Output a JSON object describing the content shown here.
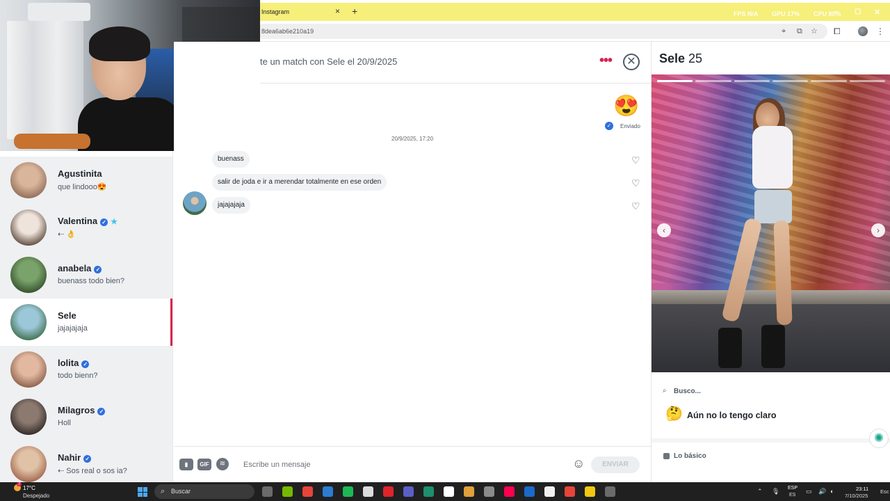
{
  "browser": {
    "tab_title": "Instagram",
    "tab_close": "×",
    "new_tab": "+",
    "url": "8dea6ab6e210a19",
    "perf_fps": "FPS N/A",
    "perf_gpu": "GPU 17%",
    "perf_cpu": "CPU 80%"
  },
  "matches": [
    {
      "name": "Agustinita",
      "last": "que lindooo😍",
      "verified": false,
      "star": false,
      "avatar_colors": [
        "#d9b59b",
        "#8f6b56"
      ]
    },
    {
      "name": "Valentina",
      "last": "⇠ 👌",
      "verified": true,
      "star": true,
      "avatar_colors": [
        "#efe4dc",
        "#5a4638"
      ]
    },
    {
      "name": "anabela",
      "last": "buenass todo bien?",
      "verified": true,
      "star": false,
      "avatar_colors": [
        "#7aa36b",
        "#324d2a"
      ]
    },
    {
      "name": "Sele",
      "last": "jajajajaja",
      "verified": false,
      "star": false,
      "avatar_colors": [
        "#9cc7d8",
        "#3e6d4a"
      ]
    },
    {
      "name": "lolita",
      "last": "todo bienn?",
      "verified": true,
      "star": false,
      "avatar_colors": [
        "#e2b9a0",
        "#8a5c48"
      ]
    },
    {
      "name": "Milagros",
      "last": "Holl",
      "verified": true,
      "star": false,
      "avatar_colors": [
        "#8c7a70",
        "#2f2825"
      ]
    },
    {
      "name": "Nahir",
      "last": "⇠ Sos real o sos ia?",
      "verified": true,
      "star": false,
      "avatar_colors": [
        "#e0c2a6",
        "#a0624a"
      ]
    }
  ],
  "chat": {
    "title": "te un match con Sele el 20/9/2025",
    "more_icon": "•••",
    "close_icon": "✕",
    "sent_emoji": "😍",
    "sent_check": "✓",
    "sent_label": "Enviado",
    "timestamp": "20/9/2025, 17:20",
    "messages": [
      "buenass",
      "salir de joda e ir a merendar totalmente en ese orden",
      "jajajajaja"
    ],
    "heart_icon": "♡",
    "gif_label": "GIF",
    "input_placeholder": "Escribe un mensaje",
    "emoji_icon": "☺",
    "send_label": "ENVIAR"
  },
  "profile": {
    "name": "Sele",
    "age": "25",
    "photo_count": 6,
    "photo_active": 0,
    "prev_icon": "‹",
    "next_icon": "›",
    "looking_label": "Busco...",
    "looking_emoji": "🤔",
    "looking_value": "Aún no lo tengo claro",
    "basics_label": "Lo básico"
  },
  "taskbar": {
    "weather_temp": "17°C",
    "weather_desc": "Despejado",
    "weather_badge": "7",
    "search_label": "Buscar",
    "lang_top": "ESP",
    "lang_bottom": "ES",
    "time": "23:11",
    "date": "7/10/2025",
    "esc_label": "Esc",
    "app_colors": [
      "#6b6b6b",
      "#76b900",
      "#e8443a",
      "#2b7cd3",
      "#1db954",
      "#dcdcdc",
      "#e0242b",
      "#5b5fc7",
      "#1d8f6f",
      "#ffffff",
      "#e0a03a",
      "#8a8a8a",
      "#ff0050",
      "#1b6ac9",
      "#f0f0f0",
      "#e8443a",
      "#f2c811",
      "#6b6b6b"
    ]
  }
}
